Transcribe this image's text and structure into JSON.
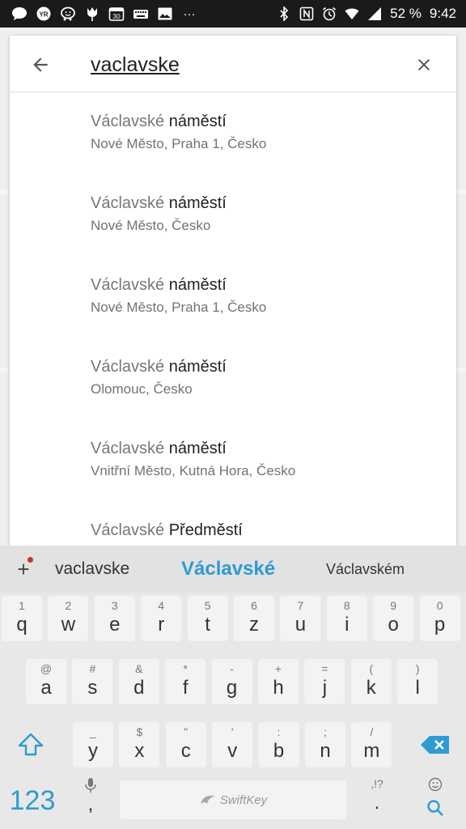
{
  "status_bar": {
    "battery": "52 %",
    "time": "9:42",
    "calendar_day": "30",
    "yr_badge": "YR",
    "more_dots": "···",
    "left_icons": [
      "chat-bubble-icon",
      "yr-icon",
      "waze-icon",
      "tulip-icon",
      "calendar-icon",
      "keyboard-icon",
      "image-icon",
      "more-icon"
    ],
    "right_icons": [
      "bluetooth-icon",
      "nfc-icon",
      "alarm-icon",
      "wifi-icon",
      "signal-icon",
      "battery-icon"
    ]
  },
  "search": {
    "query": "vaclavske",
    "back_icon": "arrow-back-icon",
    "clear_icon": "close-icon"
  },
  "results": [
    {
      "prefix": "Václavské",
      "match": "náměstí",
      "subtitle": "Nové Město, Praha 1, Česko"
    },
    {
      "prefix": "Václavské",
      "match": "náměstí",
      "subtitle": "Nové Město, Česko"
    },
    {
      "prefix": "Václavské",
      "match": "náměstí",
      "subtitle": "Nové Město, Praha 1, Česko"
    },
    {
      "prefix": "Václavské",
      "match": "náměstí",
      "subtitle": "Olomouc, Česko"
    },
    {
      "prefix": "Václavské",
      "match": "náměstí",
      "subtitle": "Vnitřní Město, Kutná Hora, Česko"
    },
    {
      "prefix": "Václavské",
      "match": "Předměstí",
      "subtitle": ""
    }
  ],
  "keyboard": {
    "suggestions": [
      "vaclavske",
      "Václavské",
      "Václavském"
    ],
    "suggest_plus": "+",
    "accent_color": "#2e9bd1",
    "row1": [
      {
        "key": "q",
        "hint": "1"
      },
      {
        "key": "w",
        "hint": "2"
      },
      {
        "key": "e",
        "hint": "3"
      },
      {
        "key": "r",
        "hint": "4"
      },
      {
        "key": "t",
        "hint": "5"
      },
      {
        "key": "z",
        "hint": "6"
      },
      {
        "key": "u",
        "hint": "7"
      },
      {
        "key": "i",
        "hint": "8"
      },
      {
        "key": "o",
        "hint": "9"
      },
      {
        "key": "p",
        "hint": "0"
      }
    ],
    "row2": [
      {
        "key": "a",
        "hint": "@"
      },
      {
        "key": "s",
        "hint": "#"
      },
      {
        "key": "d",
        "hint": "&"
      },
      {
        "key": "f",
        "hint": "*"
      },
      {
        "key": "g",
        "hint": "-"
      },
      {
        "key": "h",
        "hint": "+"
      },
      {
        "key": "j",
        "hint": "="
      },
      {
        "key": "k",
        "hint": "("
      },
      {
        "key": "l",
        "hint": ")"
      }
    ],
    "row3": [
      {
        "key": "y",
        "hint": "_"
      },
      {
        "key": "x",
        "hint": "$"
      },
      {
        "key": "c",
        "hint": "\""
      },
      {
        "key": "v",
        "hint": "'"
      },
      {
        "key": "b",
        "hint": ":"
      },
      {
        "key": "n",
        "hint": ";"
      },
      {
        "key": "m",
        "hint": "/"
      }
    ],
    "numbers_label": "123",
    "comma": ",",
    "period": ".",
    "period_hint": ",!?",
    "space_brand": "SwiftKey"
  }
}
